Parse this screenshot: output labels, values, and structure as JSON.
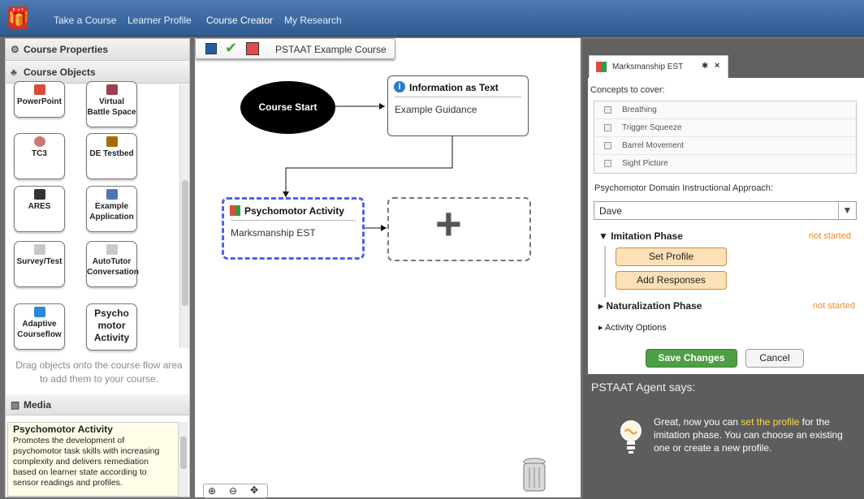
{
  "topbar": {
    "nav": [
      "Take a Course",
      "Learner Profile",
      "Course Creator",
      "My Research"
    ]
  },
  "left_panel": {
    "course_properties": "Course Properties",
    "course_objects": "Course Objects",
    "objects": [
      {
        "label": "PowerPoint",
        "icon": "powerpoint-icon",
        "color": "#d94c3a"
      },
      {
        "label": "Virtual Battle Space",
        "icon": "vbs-icon",
        "color": "#9e3f4f"
      },
      {
        "label": "TC3",
        "icon": "tc3-icon",
        "color": "#c97979"
      },
      {
        "label": "DE Testbed",
        "icon": "de-testbed-icon",
        "color": "#a86d00"
      },
      {
        "label": "ARES",
        "icon": "ares-icon",
        "color": "#333333"
      },
      {
        "label": "Example Application",
        "icon": "monitor-icon",
        "color": "#4f75b2"
      },
      {
        "label": "Survey/Test",
        "icon": "document-icon",
        "color": "#c8c8c8"
      },
      {
        "label": "AutoTutor Conversation",
        "icon": "document-icon",
        "color": "#c8c8c8"
      },
      {
        "label": "Adaptive Courseflow",
        "icon": "adaptive-icon",
        "color": "#2b88d8"
      },
      {
        "label": "Psycho motor Activity",
        "icon": "",
        "color": ""
      }
    ],
    "drag_help": "Drag objects onto the course flow area to add them to your course.",
    "media": "Media",
    "description": {
      "title": "Psychomotor Activity",
      "text": "Promotes the development of psychomotor task skills with increasing complexity and delivers remediation based on learner state according to sensor readings and profiles."
    }
  },
  "canvas": {
    "course_name": "PSTAAT Example Course",
    "course_start": "Course Start",
    "info_node": {
      "title": "Information as Text",
      "body": "Example Guidance"
    },
    "activity_node": {
      "title": "Psychomotor Activity",
      "body": "Marksmanship EST"
    },
    "add_symbol": "+"
  },
  "right_panel": {
    "tab_title": "Marksmanship EST",
    "concepts_label": "Concepts to cover:",
    "concepts": [
      "Breathing",
      "Trigger Squeeze",
      "Barrel Movement",
      "Sight Picture"
    ],
    "approach_label": "Psychomotor Domain Instructional Approach:",
    "approach_value": "Dave",
    "imitation_phase": {
      "label": "Imitation Phase",
      "status": "not started"
    },
    "set_profile": "Set Profile",
    "add_responses": "Add Responses",
    "naturalization_phase": {
      "label": "Naturalization Phase",
      "status": "not started"
    },
    "activity_options": "Activity Options",
    "save_changes": "Save Changes",
    "cancel": "Cancel"
  },
  "agent": {
    "title": "PSTAAT Agent says:",
    "message_prefix": "Great, now you can ",
    "message_highlight": "set the profile",
    "message_suffix": " for the imitation phase. You can choose an existing one or create a new profile."
  },
  "colors": {
    "topbar": "#3f6aa3",
    "accent_orange": "#f0892a",
    "save_green": "#4d9f43",
    "agent_highlight": "#ffd84a"
  }
}
